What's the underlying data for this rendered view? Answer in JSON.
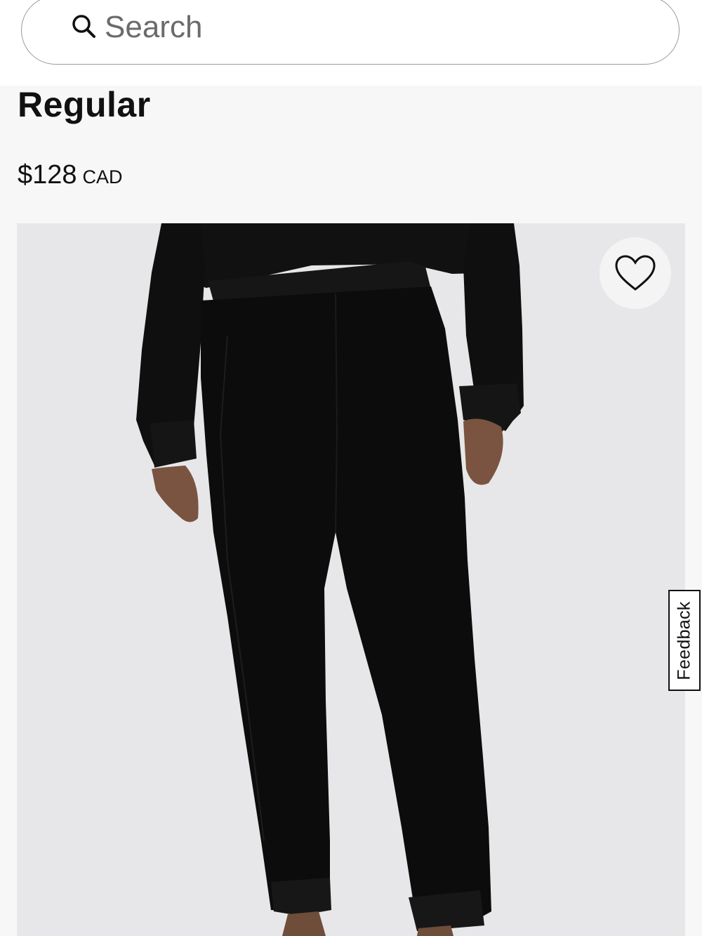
{
  "search": {
    "placeholder": "Search",
    "value": ""
  },
  "product": {
    "title": "Regular",
    "price_amount": "$128",
    "price_currency": "CAD"
  },
  "wishlist": {
    "icon": "heart-outline-icon"
  },
  "feedback": {
    "label": "Feedback"
  },
  "colors": {
    "page_background": "#f7f7f7",
    "image_background": "#e7e7e9",
    "garment": "#0d0d0d",
    "text": "#111111"
  }
}
